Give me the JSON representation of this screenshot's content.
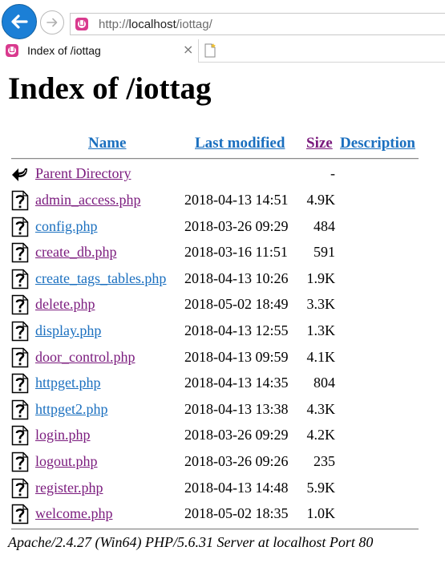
{
  "browser": {
    "url_prefix": "http://",
    "url_host": "localhost",
    "url_path": "/iottag/",
    "tab_title": "Index of /iottag",
    "tab_close": "×"
  },
  "page": {
    "heading": "Index of /iottag",
    "columns": {
      "name": "Name",
      "last_modified": "Last modified",
      "size": "Size",
      "description": "Description"
    },
    "parent": {
      "name": "Parent Directory",
      "size": "-"
    },
    "files": [
      {
        "name": "admin_access.php",
        "modified": "2018-04-13 14:51",
        "size": "4.9K",
        "visited": true
      },
      {
        "name": "config.php",
        "modified": "2018-03-26 09:29",
        "size": "484",
        "visited": false
      },
      {
        "name": "create_db.php",
        "modified": "2018-03-16 11:51",
        "size": "591",
        "visited": true
      },
      {
        "name": "create_tags_tables.php",
        "modified": "2018-04-13 10:26",
        "size": "1.9K",
        "visited": false
      },
      {
        "name": "delete.php",
        "modified": "2018-05-02 18:49",
        "size": "3.3K",
        "visited": true
      },
      {
        "name": "display.php",
        "modified": "2018-04-13 12:55",
        "size": "1.3K",
        "visited": false
      },
      {
        "name": "door_control.php",
        "modified": "2018-04-13 09:59",
        "size": "4.1K",
        "visited": true
      },
      {
        "name": "httpget.php",
        "modified": "2018-04-13 14:35",
        "size": "804",
        "visited": false
      },
      {
        "name": "httpget2.php",
        "modified": "2018-04-13 13:38",
        "size": "4.3K",
        "visited": false
      },
      {
        "name": "login.php",
        "modified": "2018-03-26 09:29",
        "size": "4.2K",
        "visited": true
      },
      {
        "name": "logout.php",
        "modified": "2018-03-26 09:26",
        "size": "235",
        "visited": true
      },
      {
        "name": "register.php",
        "modified": "2018-04-13 14:48",
        "size": "5.9K",
        "visited": true
      },
      {
        "name": "welcome.php",
        "modified": "2018-05-02 18:35",
        "size": "1.0K",
        "visited": true
      }
    ],
    "footer": "Apache/2.4.27 (Win64) PHP/5.6.31 Server at localhost Port 80"
  },
  "icons": {
    "back": "back-arrow-icon",
    "forward": "forward-arrow-icon",
    "favicon": "wampserver-favicon-icon",
    "new_tab": "new-tab-icon",
    "parent": "parent-directory-arrow-icon",
    "file": "unknown-file-icon"
  },
  "colors": {
    "visited_link": "#7a1a7d",
    "link": "#1a6fbf",
    "back_button": "#1b7fd6",
    "favicon": "#d93a8e"
  }
}
